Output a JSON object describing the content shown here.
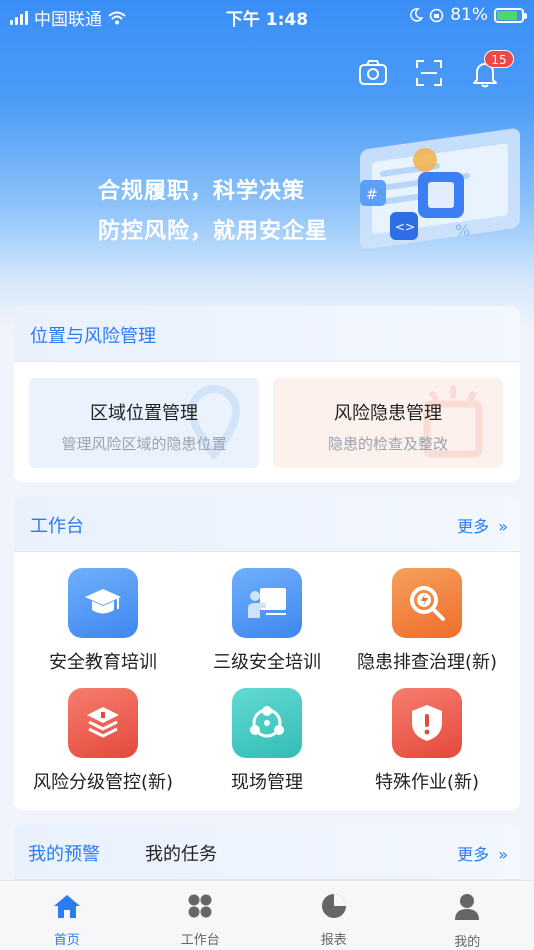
{
  "status_bar": {
    "carrier": "中国联通",
    "time": "下午 1:48",
    "battery": "81%"
  },
  "header": {
    "notification_count": "15"
  },
  "banner": {
    "line1": "合规履职，科学决策",
    "line2": "防控风险，就用安企星"
  },
  "location_risk": {
    "title": "位置与风险管理",
    "items": [
      {
        "title": "区域位置管理",
        "subtitle": "管理风险区域的隐患位置"
      },
      {
        "title": "风险隐患管理",
        "subtitle": "隐患的检查及整改"
      }
    ]
  },
  "workbench": {
    "title": "工作台",
    "more": "更多",
    "items": [
      {
        "label": "安全教育培训",
        "icon": "graduation-cap-icon",
        "color": "#4b93f3"
      },
      {
        "label": "三级安全培训",
        "icon": "presenter-board-icon",
        "color": "#4b93f3"
      },
      {
        "label": "隐患排查治理(新)",
        "icon": "search-alert-icon",
        "color": "#f0782f"
      },
      {
        "label": "风险分级管控(新)",
        "icon": "layers-icon",
        "color": "#ef5a4c"
      },
      {
        "label": "现场管理",
        "icon": "network-icon",
        "color": "#3cc7c2"
      },
      {
        "label": "特殊作业(新)",
        "icon": "shield-alert-icon",
        "color": "#ef5a4c"
      }
    ]
  },
  "alerts": {
    "tab_warning": "我的预警",
    "tab_tasks": "我的任务",
    "more": "更多"
  },
  "tabbar": [
    {
      "label": "首页",
      "icon": "home-icon"
    },
    {
      "label": "工作台",
      "icon": "grid-icon"
    },
    {
      "label": "报表",
      "icon": "pie-chart-icon"
    },
    {
      "label": "我的",
      "icon": "user-icon"
    }
  ],
  "colors": {
    "accent": "#2b7cf0",
    "badge": "#f04848"
  }
}
